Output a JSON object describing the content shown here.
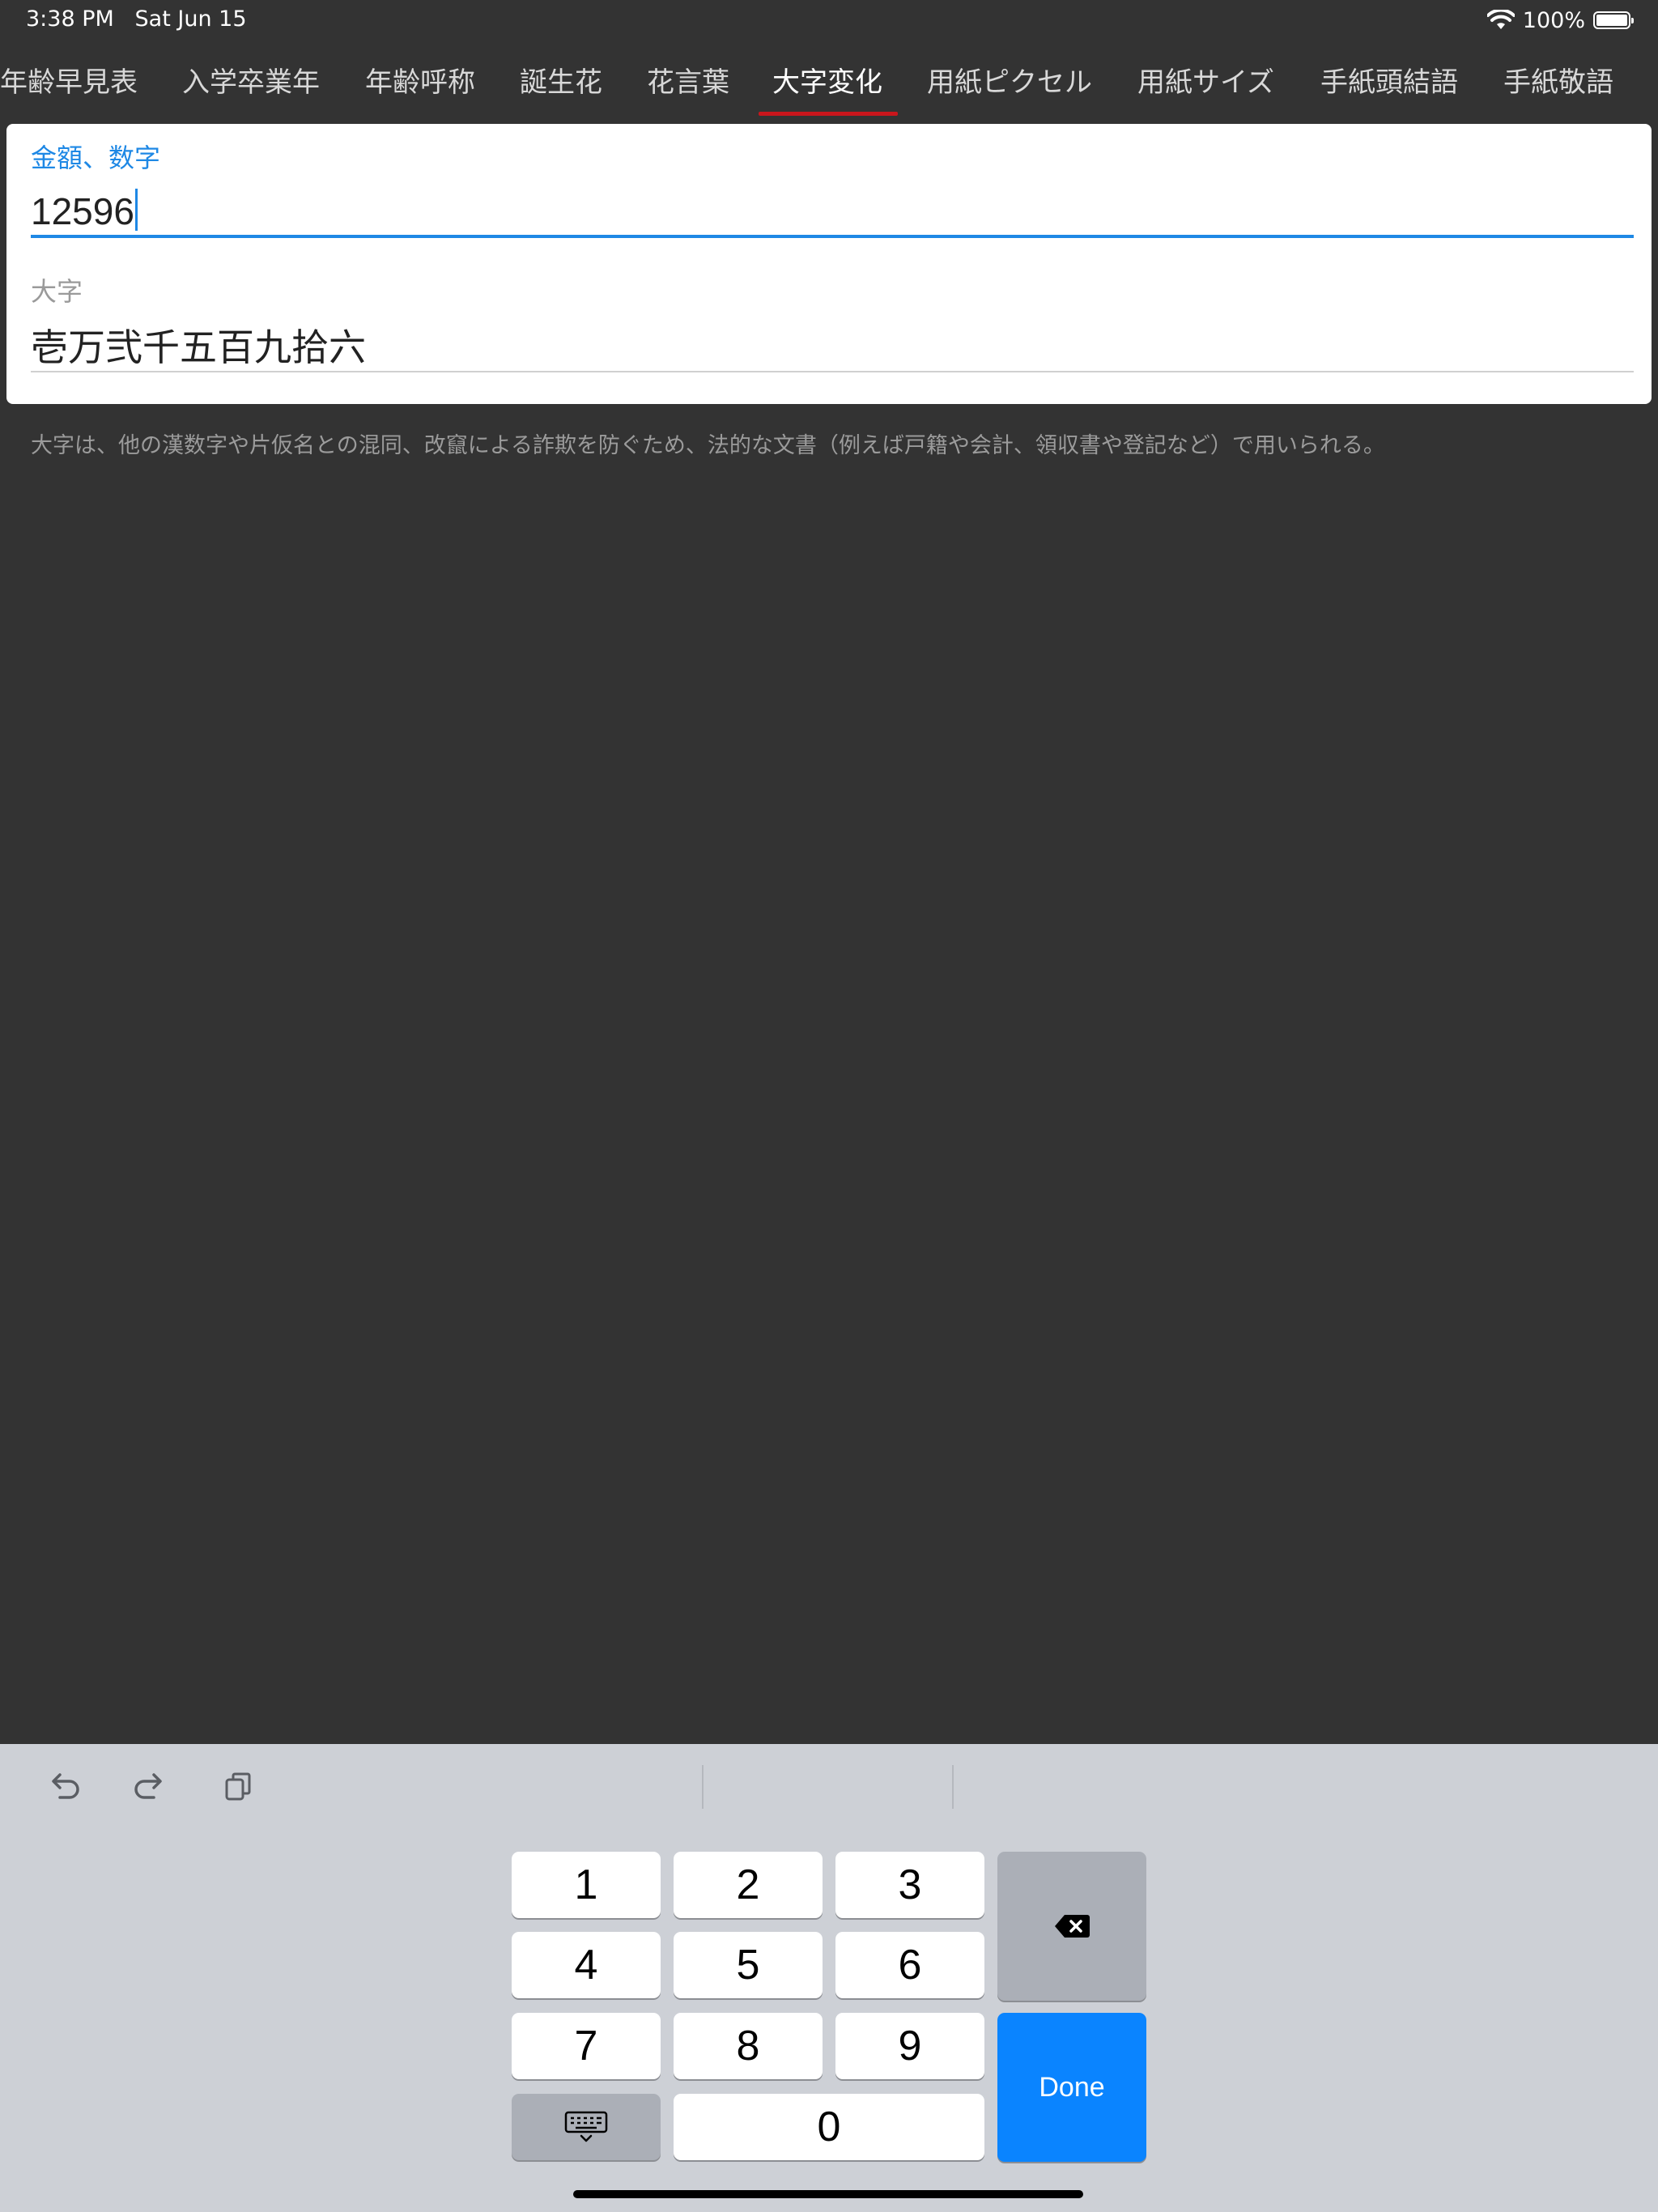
{
  "status_bar": {
    "time": "3:38 PM",
    "date": "Sat Jun 15",
    "battery": "100%",
    "wifi_icon": "wifi-icon",
    "battery_icon": "battery-icon"
  },
  "tabs": [
    {
      "label": "年齢早見表"
    },
    {
      "label": "入学卒業年"
    },
    {
      "label": "年齢呼称"
    },
    {
      "label": "誕生花"
    },
    {
      "label": "花言葉"
    },
    {
      "label": "大字変化"
    },
    {
      "label": "用紙ピクセル"
    },
    {
      "label": "用紙サイズ"
    },
    {
      "label": "手紙頭結語"
    },
    {
      "label": "手紙敬語"
    }
  ],
  "active_tab": "大字変化",
  "form": {
    "amount_label": "金額、数字",
    "amount_value": "12596",
    "daiji_label": "大字",
    "daiji_value": "壱万弐千五百九拾六"
  },
  "note": "大字は、他の漢数字や片仮名との混同、改竄による詐欺を防ぐため、法的な文書（例えば戸籍や会計、領収書や登記など）で用いられる。",
  "keyboard": {
    "keys": [
      "1",
      "2",
      "3",
      "4",
      "5",
      "6",
      "7",
      "8",
      "9",
      "0"
    ],
    "done_label": "Done",
    "toolbar_icons": [
      "undo-icon",
      "redo-icon",
      "paste-icon"
    ]
  },
  "colors": {
    "accent": "#1e88e5",
    "tab_indicator": "#c9161c",
    "done_key": "#0a84ff",
    "background": "#333333"
  }
}
